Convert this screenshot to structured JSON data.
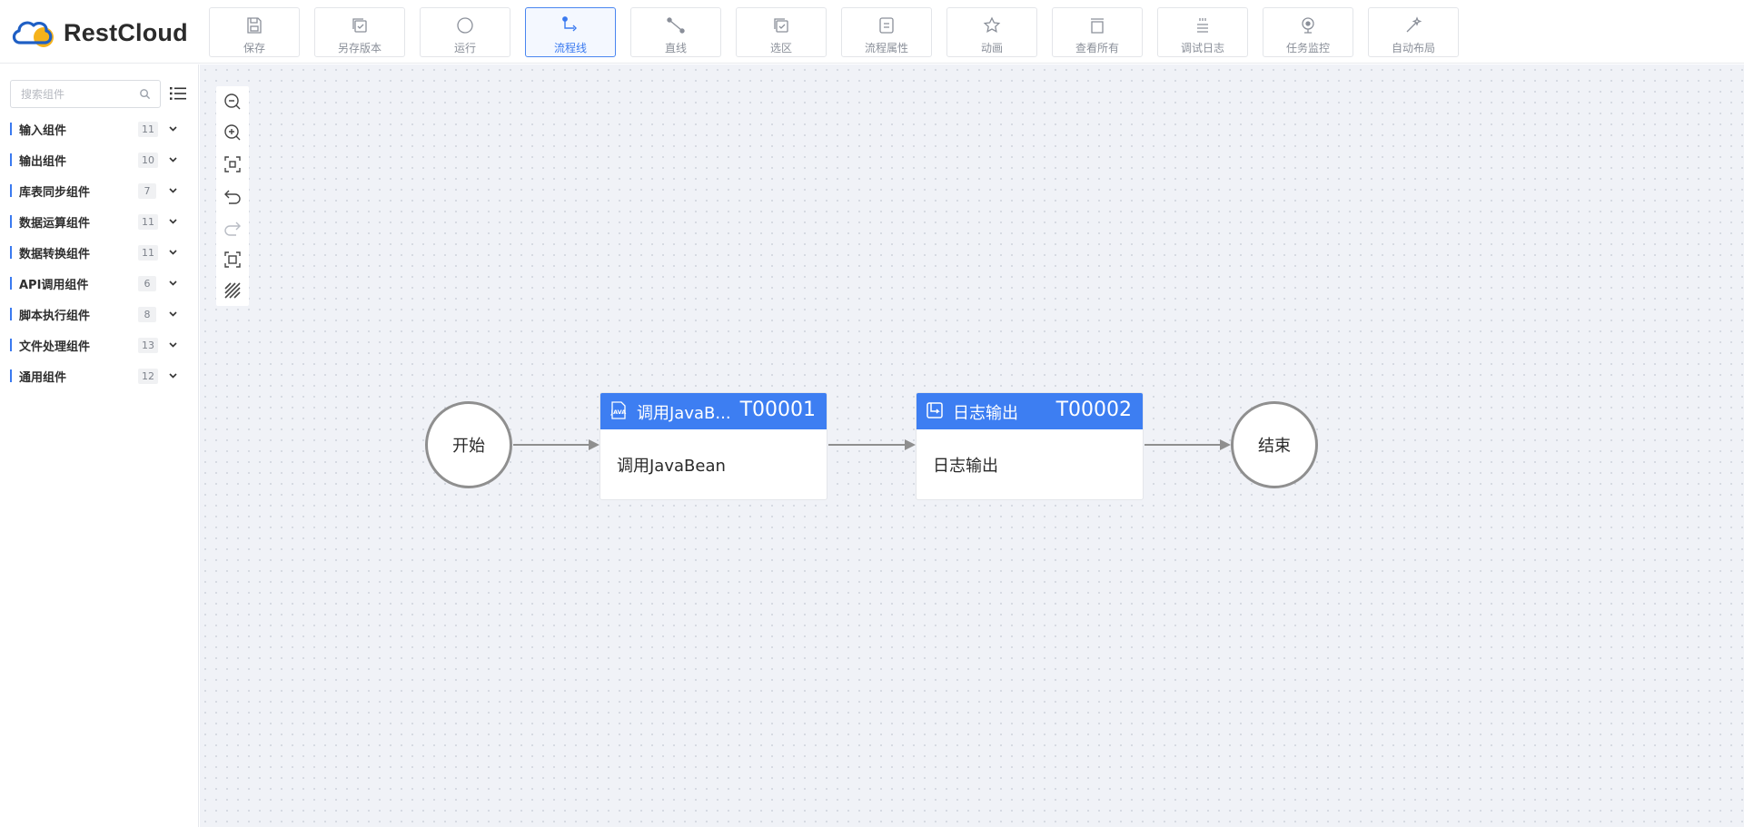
{
  "app": {
    "brand": "RestCloud"
  },
  "toolbar": {
    "buttons": [
      {
        "label": "保存",
        "icon": "save-icon"
      },
      {
        "label": "另存版本",
        "icon": "save-as-version-icon"
      },
      {
        "label": "运行",
        "icon": "run-icon"
      },
      {
        "label": "流程线",
        "icon": "flow-line-icon",
        "active": true
      },
      {
        "label": "直线",
        "icon": "straight-line-icon"
      },
      {
        "label": "选区",
        "icon": "selection-icon"
      },
      {
        "label": "流程属性",
        "icon": "flow-properties-icon"
      },
      {
        "label": "动画",
        "icon": "animation-icon"
      },
      {
        "label": "查看所有",
        "icon": "view-all-icon"
      },
      {
        "label": "调试日志",
        "icon": "debug-log-icon"
      },
      {
        "label": "任务监控",
        "icon": "task-monitor-icon"
      },
      {
        "label": "自动布局",
        "icon": "auto-layout-icon"
      }
    ]
  },
  "sidebar": {
    "search": {
      "placeholder": "搜索组件",
      "value": ""
    },
    "categories": [
      {
        "label": "输入组件",
        "count": "11"
      },
      {
        "label": "输出组件",
        "count": "10"
      },
      {
        "label": "库表同步组件",
        "count": "7"
      },
      {
        "label": "数据运算组件",
        "count": "11"
      },
      {
        "label": "数据转换组件",
        "count": "11"
      },
      {
        "label": "API调用组件",
        "count": "6"
      },
      {
        "label": "脚本执行组件",
        "count": "8"
      },
      {
        "label": "文件处理组件",
        "count": "13"
      },
      {
        "label": "通用组件",
        "count": "12"
      }
    ]
  },
  "canvas_tools": [
    {
      "icon": "zoom-out-icon"
    },
    {
      "icon": "zoom-in-icon"
    },
    {
      "icon": "fit-view-icon"
    },
    {
      "icon": "undo-icon"
    },
    {
      "icon": "redo-icon",
      "disabled": true
    },
    {
      "icon": "actual-size-icon"
    },
    {
      "icon": "grid-toggle-icon"
    }
  ],
  "flow": {
    "start": {
      "label": "开始"
    },
    "end": {
      "label": "结束"
    },
    "tasks": [
      {
        "title": "调用JavaB...",
        "code": "T00001",
        "body": "调用JavaBean",
        "icon": "java-icon"
      },
      {
        "title": "日志输出",
        "code": "T00002",
        "body": "日志输出",
        "icon": "log-file-icon"
      }
    ]
  },
  "colors": {
    "accent": "#3d7ef2",
    "canvas_bg": "#f0f2f7",
    "node_border": "#8f8f8f",
    "edge": "#8f8f8f"
  }
}
